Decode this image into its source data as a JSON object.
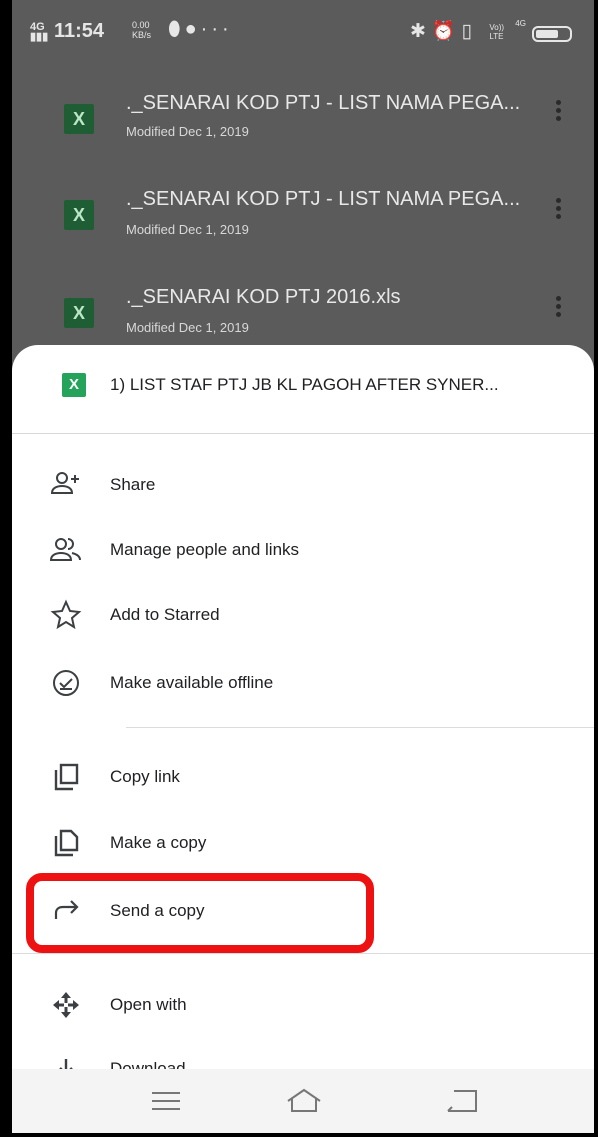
{
  "status_bar": {
    "signal": "4G",
    "time": "11:54",
    "net_speed_value": "0.00",
    "net_speed_unit": "KB/s",
    "more": "···",
    "lte_top": "Vo))",
    "lte_bottom": "LTE",
    "lte_gen": "4G",
    "icon_names": [
      "signal-icon",
      "leaf-icon",
      "circle-icon",
      "bluetooth-icon",
      "alarm-icon",
      "vibrate-icon",
      "battery-icon"
    ]
  },
  "files": [
    {
      "name": "._SENARAI KOD PTJ - LIST NAMA PEGA...",
      "modified": "Modified Dec 1, 2019",
      "badge": "X"
    },
    {
      "name": "._SENARAI KOD PTJ - LIST NAMA PEGA...",
      "modified": "Modified Dec 1, 2019",
      "badge": "X"
    },
    {
      "name": "._SENARAI KOD PTJ 2016.xls",
      "modified": "Modified Dec 1, 2019",
      "badge": "X"
    }
  ],
  "sheet": {
    "badge": "X",
    "title": "1) LIST STAF PTJ JB KL PAGOH AFTER SYNER...",
    "items": [
      {
        "label": "Share",
        "icon": "person-add-icon"
      },
      {
        "label": "Manage people and links",
        "icon": "people-icon"
      },
      {
        "label": "Add to Starred",
        "icon": "star-icon"
      },
      {
        "label": "Make available offline",
        "icon": "offline-check-icon"
      },
      {
        "label": "Copy link",
        "icon": "copy-link-icon"
      },
      {
        "label": "Make a copy",
        "icon": "file-copy-icon"
      },
      {
        "label": "Send a copy",
        "icon": "share-arrow-icon"
      },
      {
        "label": "Open with",
        "icon": "open-with-icon"
      },
      {
        "label": "Download",
        "icon": "download-icon"
      }
    ]
  },
  "colors": {
    "highlight": "#ee1111",
    "excel_green": "#25a35a",
    "scrim": "#5b5b5b"
  }
}
